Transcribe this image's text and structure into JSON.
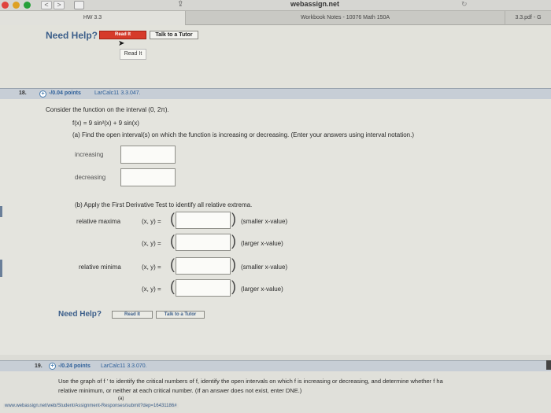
{
  "browser": {
    "url": "webassign.net",
    "back_label": "<",
    "forward_label": ">",
    "share_label": "⇪",
    "reload_label": "↻"
  },
  "tabs": [
    {
      "label": "HW 3.3"
    },
    {
      "label": "Workbook Notes - 10076 Math 150A"
    },
    {
      "label": "3.3.pdf - G"
    }
  ],
  "help_top": {
    "need_help": "Need Help?",
    "read_it": "Read It",
    "talk_to_tutor": "Talk to a Tutor",
    "tooltip": "Read It"
  },
  "q18": {
    "number": "18.",
    "points": "-/0.04 points",
    "source": "LarCalc11 3.3.047.",
    "intro": "Consider the function on the interval (0, 2π).",
    "function": "f(x) = 9 sin²(x) + 9 sin(x)",
    "part_a": "(a) Find the open interval(s) on which the function is increasing or decreasing. (Enter your answers using interval notation.)",
    "increasing_label": "increasing",
    "decreasing_label": "decreasing",
    "part_b": "(b) Apply the First Derivative Test to identify all relative extrema.",
    "relative_maxima_label": "relative maxima",
    "relative_minima_label": "relative minima",
    "xy_label": "(x, y) =",
    "smaller_x": "(smaller x-value)",
    "larger_x": "(larger x-value)"
  },
  "help_bottom": {
    "need_help": "Need Help?",
    "read_it": "Read It",
    "talk_to_tutor": "Talk to a Tutor"
  },
  "q19": {
    "number": "19.",
    "points": "-/0.24 points",
    "source": "LarCalc11 3.3.070.",
    "line1": "Use the graph of f ' to identify the critical numbers of f, identify the open intervals on which f is increasing or decreasing, and determine whether f ha",
    "line2": "relative minimum, or neither at each critical number. (If an answer does not exist, enter DNE.)",
    "part_a_label": "(a)"
  },
  "status_bar": {
    "url": "www.webassign.net/web/Student/Assignment-Responses/submit?dep=16431186#"
  }
}
